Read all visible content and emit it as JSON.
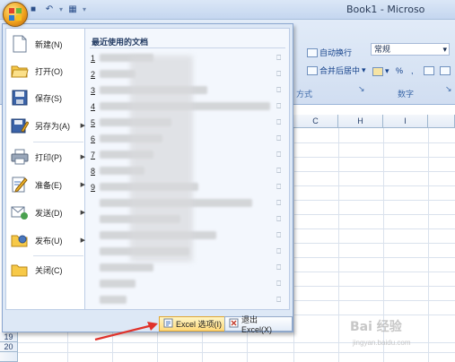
{
  "window": {
    "title": "Book1 - Microso"
  },
  "ribbon": {
    "wrap_text": "自动换行",
    "merge_center": "合并后居中",
    "number_format": "常规",
    "percent": "%",
    "comma": ",",
    "align_group_label": "方式",
    "number_group_label": "数字"
  },
  "columns": [
    "C",
    "H",
    "I"
  ],
  "rows": [
    "19",
    "20"
  ],
  "menu": {
    "items": [
      {
        "label": "新建(N)",
        "icon": "new-document-icon"
      },
      {
        "label": "打开(O)",
        "icon": "open-folder-icon"
      },
      {
        "label": "保存(S)",
        "icon": "save-disk-icon"
      },
      {
        "label": "另存为(A)",
        "icon": "save-as-icon"
      },
      {
        "label": "打印(P)",
        "icon": "printer-icon"
      },
      {
        "label": "准备(E)",
        "icon": "prepare-icon"
      },
      {
        "label": "发送(D)",
        "icon": "send-icon"
      },
      {
        "label": "发布(U)",
        "icon": "publish-icon"
      },
      {
        "label": "关闭(C)",
        "icon": "close-folder-icon"
      }
    ],
    "recent_title": "最近使用的文档",
    "recent_numbers": [
      "1",
      "2",
      "3",
      "4",
      "5",
      "6",
      "7",
      "8",
      "9"
    ],
    "excel_options": "Excel 选项(I)",
    "exit_excel": "退出 Excel(X)"
  },
  "watermark": {
    "main": "Bai 经验",
    "sub": "jingyan.baidu.com"
  },
  "colors": {
    "menu_bg": "#dde8f6",
    "highlight": "#ffd97a",
    "arrow": "#e0322b"
  }
}
